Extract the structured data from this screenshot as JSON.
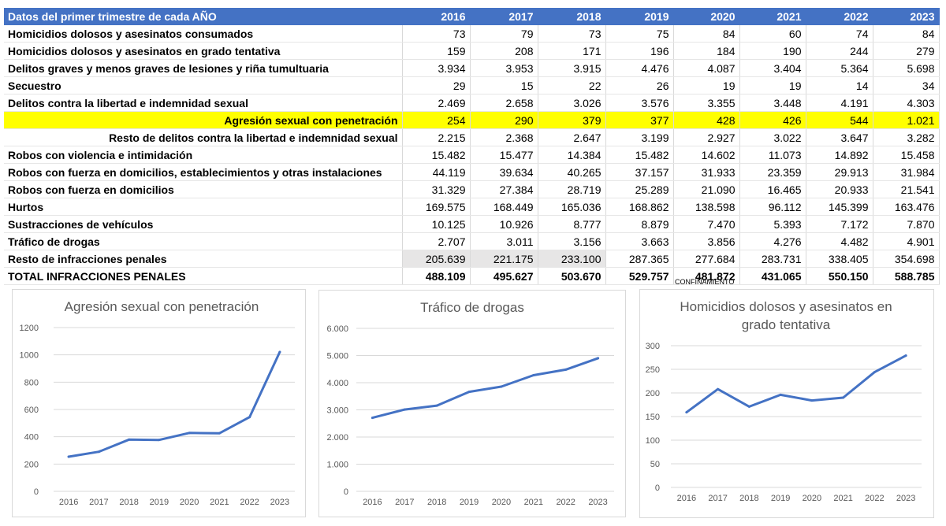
{
  "table": {
    "header_label": "Datos del primer trimestre de cada AÑO",
    "years": [
      "2016",
      "2017",
      "2018",
      "2019",
      "2020",
      "2021",
      "2022",
      "2023"
    ],
    "rows": [
      {
        "label": "Homicidios dolosos y asesinatos consumados",
        "values": [
          "73",
          "79",
          "73",
          "75",
          "84",
          "60",
          "74",
          "84"
        ]
      },
      {
        "label": "Homicidios dolosos y asesinatos en grado tentativa",
        "values": [
          "159",
          "208",
          "171",
          "196",
          "184",
          "190",
          "244",
          "279"
        ]
      },
      {
        "label": "Delitos graves y menos graves de lesiones y riña tumultuaria",
        "values": [
          "3.934",
          "3.953",
          "3.915",
          "4.476",
          "4.087",
          "3.404",
          "5.364",
          "5.698"
        ]
      },
      {
        "label": "Secuestro",
        "values": [
          "29",
          "15",
          "22",
          "26",
          "19",
          "19",
          "14",
          "34"
        ]
      },
      {
        "label": "Delitos contra la libertad e indemnidad sexual",
        "values": [
          "2.469",
          "2.658",
          "3.026",
          "3.576",
          "3.355",
          "3.448",
          "4.191",
          "4.303"
        ]
      },
      {
        "label": "Agresión sexual con penetración",
        "values": [
          "254",
          "290",
          "379",
          "377",
          "428",
          "426",
          "544",
          "1.021"
        ]
      },
      {
        "label": "Resto de delitos contra la libertad e indemnidad sexual",
        "values": [
          "2.215",
          "2.368",
          "2.647",
          "3.199",
          "2.927",
          "3.022",
          "3.647",
          "3.282"
        ]
      },
      {
        "label": "Robos con violencia e intimidación",
        "values": [
          "15.482",
          "15.477",
          "14.384",
          "15.482",
          "14.602",
          "11.073",
          "14.892",
          "15.458"
        ]
      },
      {
        "label": "Robos con fuerza en domicilios, establecimientos y otras instalaciones",
        "values": [
          "44.119",
          "39.634",
          "40.265",
          "37.157",
          "31.933",
          "23.359",
          "29.913",
          "31.984"
        ]
      },
      {
        "label": "Robos con fuerza en domicilios",
        "values": [
          "31.329",
          "27.384",
          "28.719",
          "25.289",
          "21.090",
          "16.465",
          "20.933",
          "21.541"
        ]
      },
      {
        "label": "Hurtos",
        "values": [
          "169.575",
          "168.449",
          "165.036",
          "168.862",
          "138.598",
          "96.112",
          "145.399",
          "163.476"
        ]
      },
      {
        "label": "Sustracciones de vehículos",
        "values": [
          "10.125",
          "10.926",
          "8.777",
          "8.879",
          "7.470",
          "5.393",
          "7.172",
          "7.870"
        ]
      },
      {
        "label": "Tráfico de drogas",
        "values": [
          "2.707",
          "3.011",
          "3.156",
          "3.663",
          "3.856",
          "4.276",
          "4.482",
          "4.901"
        ]
      },
      {
        "label": "Resto de infracciones penales",
        "values": [
          "205.639",
          "221.175",
          "233.100",
          "287.365",
          "277.684",
          "283.731",
          "338.405",
          "354.698"
        ]
      },
      {
        "label": "TOTAL INFRACCIONES PENALES",
        "values": [
          "488.109",
          "495.627",
          "503.670",
          "529.757",
          "481.872",
          "431.065",
          "550.150",
          "588.785"
        ]
      }
    ]
  },
  "note": "CONFINAMIENTO",
  "colors": {
    "header_bg": "#4472c4",
    "highlight": "#ffff00",
    "line": "#4472c4",
    "gray_cell": "#e7e6e6"
  },
  "chart_data": [
    {
      "type": "line",
      "title": "Agresión sexual con penetración",
      "x": [
        "2016",
        "2017",
        "2018",
        "2019",
        "2020",
        "2021",
        "2022",
        "2023"
      ],
      "values": [
        254,
        290,
        379,
        377,
        428,
        426,
        544,
        1021
      ],
      "ylim": [
        0,
        1200
      ],
      "yticks": [
        "0",
        "200",
        "400",
        "600",
        "800",
        "1000",
        "1200"
      ],
      "grid": true
    },
    {
      "type": "line",
      "title": "Tráfico de drogas",
      "x": [
        "2016",
        "2017",
        "2018",
        "2019",
        "2020",
        "2021",
        "2022",
        "2023"
      ],
      "values": [
        2707,
        3011,
        3156,
        3663,
        3856,
        4276,
        4482,
        4901
      ],
      "ylim": [
        0,
        6000
      ],
      "yticks": [
        "0",
        "1.000",
        "2.000",
        "3.000",
        "4.000",
        "5.000",
        "6.000"
      ],
      "grid": true
    },
    {
      "type": "line",
      "title": "Homicidios dolosos y asesinatos en grado tentativa",
      "title_lines": [
        "Homicidios dolosos y asesinatos en",
        "grado tentativa"
      ],
      "x": [
        "2016",
        "2017",
        "2018",
        "2019",
        "2020",
        "2021",
        "2022",
        "2023"
      ],
      "values": [
        159,
        208,
        171,
        196,
        184,
        190,
        244,
        279
      ],
      "ylim": [
        0,
        300
      ],
      "yticks": [
        "0",
        "50",
        "100",
        "150",
        "200",
        "250",
        "300"
      ],
      "grid": true
    }
  ]
}
